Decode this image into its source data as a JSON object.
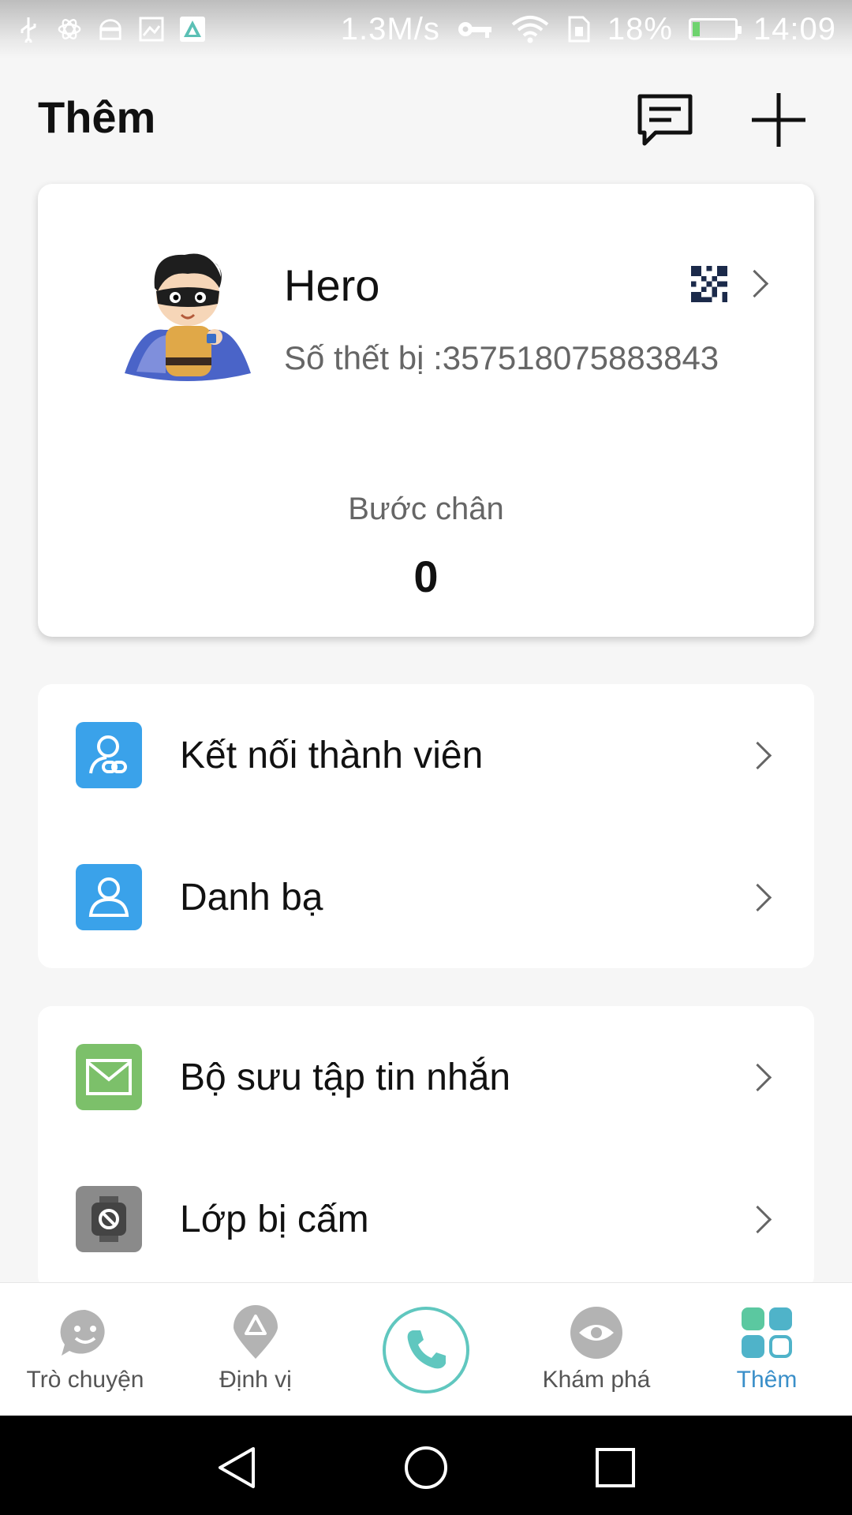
{
  "status_bar": {
    "speed": "1.3M/s",
    "battery_percent": "18%",
    "time": "14:09",
    "battery_level": 0.18
  },
  "header": {
    "title": "Thêm",
    "icons": [
      "message-icon",
      "add-icon"
    ]
  },
  "profile": {
    "name": "Hero",
    "device_label": "Số thết bị :357518075883843",
    "steps_label": "Bước chân",
    "steps_value": "0"
  },
  "menu_group_1": [
    {
      "label": "Kết nối thành viên",
      "icon": "member-link-icon",
      "color": "#3aa2ea"
    },
    {
      "label": "Danh bạ",
      "icon": "contacts-icon",
      "color": "#3aa2ea"
    }
  ],
  "menu_group_2": [
    {
      "label": "Bộ sưu tập tin nhắn",
      "icon": "message-collection-icon",
      "color": "#7cc06a"
    },
    {
      "label": "Lớp bị cấm",
      "icon": "banned-class-icon",
      "color": "#8a8a8a"
    }
  ],
  "bottom_nav": {
    "items": [
      {
        "label": "Trò chuyện",
        "icon": "chat-icon"
      },
      {
        "label": "Định vị",
        "icon": "location-icon"
      },
      {
        "label": "",
        "icon": "phone-icon"
      },
      {
        "label": "Khám phá",
        "icon": "explore-icon"
      },
      {
        "label": "Thêm",
        "icon": "more-apps-icon"
      }
    ],
    "active_index": 4,
    "active_color": "#3a8fc9",
    "call_color": "#60c7bf"
  }
}
